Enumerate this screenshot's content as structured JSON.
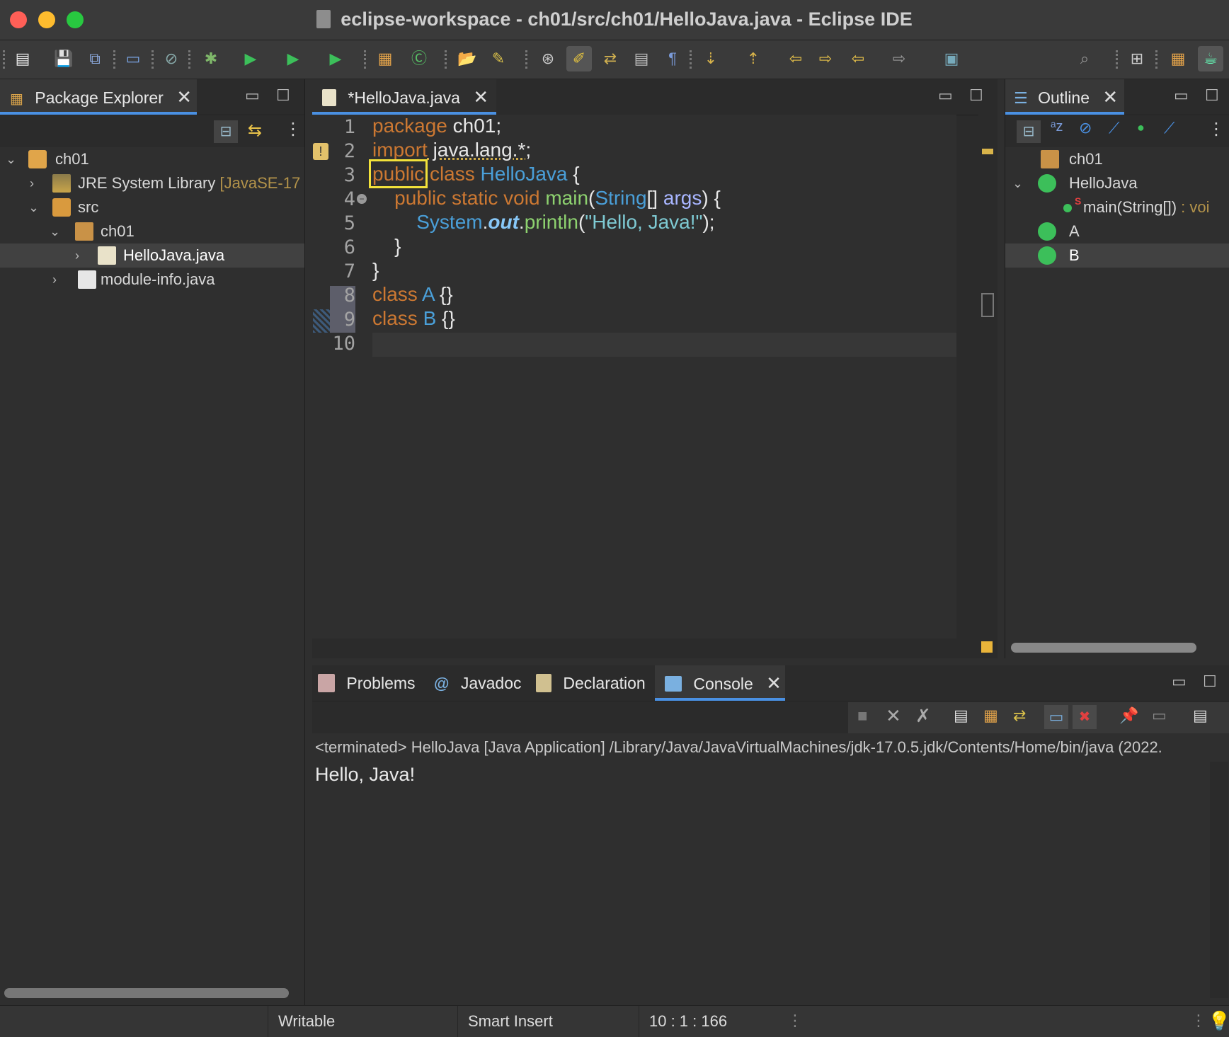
{
  "window": {
    "title": "eclipse-workspace - ch01/src/ch01/HelloJava.java - Eclipse IDE",
    "traffic_colors": {
      "close": "#ff5f57",
      "minimize": "#febc2e",
      "zoom": "#28c840"
    }
  },
  "package_explorer": {
    "tab_label": "Package Explorer",
    "tree": [
      {
        "label": "ch01",
        "suffix": ""
      },
      {
        "label": "JRE System Library",
        "suffix": " [JavaSE-17"
      },
      {
        "label": "src",
        "suffix": ""
      },
      {
        "label": "ch01",
        "suffix": ""
      },
      {
        "label": "HelloJava.java",
        "suffix": ""
      },
      {
        "label": "module-info.java",
        "suffix": ""
      }
    ]
  },
  "editor": {
    "tab_label": "*HelloJava.java",
    "line_numbers": [
      "1",
      "2",
      "3",
      "4",
      "5",
      "6",
      "7",
      "8",
      "9",
      "10"
    ],
    "code": {
      "l1": {
        "kw": "package",
        "rest": " ch01;"
      },
      "l2": {
        "kw": "import",
        "rest": " java.lang.*;"
      },
      "l3": {
        "kw1": "public",
        "kw2": " class ",
        "name": "HelloJava",
        "rest": " {"
      },
      "l4": {
        "kw": "    public static void ",
        "fn": "main",
        "p1": "(",
        "ty": "String",
        "p2": "[] ",
        "param": "args",
        "p3": ") {"
      },
      "l5": {
        "ty": "        System",
        "dot1": ".",
        "fld": "out",
        "dot2": ".",
        "fn": "println",
        "p1": "(",
        "str": "\"Hello, Java!\"",
        "p2": ");"
      },
      "l6": {
        "plain": "    }"
      },
      "l7": {
        "plain": "}"
      },
      "l8": {
        "kw": "class ",
        "name": "A",
        "rest": " {}"
      },
      "l9": {
        "kw": "class ",
        "name": "B",
        "rest": " {}"
      }
    },
    "highlight_color": "#f2e23a"
  },
  "outline": {
    "tab_label": "Outline",
    "items": [
      {
        "label": "ch01"
      },
      {
        "label": "HelloJava"
      },
      {
        "label": "main(String[])",
        "suffix": " : voi"
      },
      {
        "label": "A"
      },
      {
        "label": "B"
      }
    ]
  },
  "bottom_tabs": {
    "problems": "Problems",
    "javadoc": "Javadoc",
    "declaration": "Declaration",
    "console": "Console"
  },
  "console": {
    "header": "<terminated> HelloJava [Java Application] /Library/Java/JavaVirtualMachines/jdk-17.0.5.jdk/Contents/Home/bin/java  (2022.",
    "output": "Hello, Java!"
  },
  "status": {
    "writable": "Writable",
    "insert_mode": "Smart Insert",
    "position": "10 : 1 : 166"
  }
}
